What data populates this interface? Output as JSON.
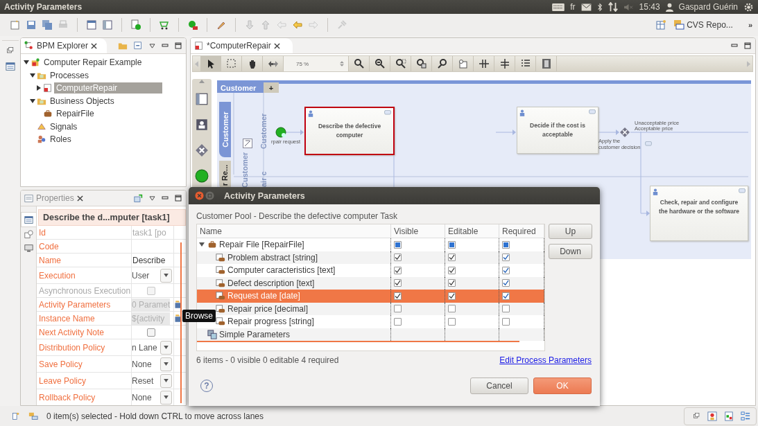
{
  "window": {
    "title": "Activity Parameters"
  },
  "top_panel": {
    "keyboard_layout": "fr",
    "clock": "15:43",
    "user": "Gaspard Guérin"
  },
  "toolbar": {
    "perspective": "CVS Repo...",
    "overflow": "»"
  },
  "explorer": {
    "title": "BPM Explorer",
    "tree": [
      {
        "label": "Computer Repair Example",
        "kind": "project",
        "expanded": true,
        "selected": false,
        "children": [
          {
            "label": "Processes",
            "kind": "folder",
            "expanded": true,
            "selected": false,
            "children": [
              {
                "label": "ComputerRepair",
                "kind": "process",
                "selected": true
              }
            ]
          },
          {
            "label": "Business Objects",
            "kind": "folder",
            "expanded": true,
            "selected": false,
            "children": [
              {
                "label": "RepairFile",
                "kind": "object",
                "selected": false
              }
            ]
          },
          {
            "label": "Signals",
            "kind": "signal",
            "selected": false
          },
          {
            "label": "Roles",
            "kind": "role",
            "selected": false
          }
        ]
      }
    ]
  },
  "properties": {
    "title": "Properties",
    "header": "Describe the d...mputer [task1]",
    "rows": [
      {
        "label": "Id",
        "kind": "readonly",
        "value": "task1  [po",
        "disabled": false
      },
      {
        "label": "Code",
        "kind": "text",
        "disabled": false
      },
      {
        "label": "Name",
        "kind": "text",
        "value": "Describe",
        "disabled": false
      },
      {
        "label": "Execution",
        "kind": "combo",
        "value": "User",
        "disabled": false
      },
      {
        "label": "Asynchronous Execution",
        "kind": "checkbox",
        "checked": false,
        "disabled": true
      },
      {
        "label": "Activity Parameters",
        "kind": "browse",
        "value": "0 Paramet",
        "disabled": false
      },
      {
        "label": "Instance Name",
        "kind": "browse",
        "value": "${activity",
        "disabled": false
      },
      {
        "label": "Next Activity Note",
        "kind": "checkbox",
        "checked": false,
        "disabled": false
      },
      {
        "label": "Distribution Policy",
        "kind": "combo",
        "value": "n Lane",
        "disabled": false
      },
      {
        "label": "Save Policy",
        "kind": "combo",
        "value": "None",
        "disabled": false
      },
      {
        "label": "Leave Policy",
        "kind": "combo",
        "value": "Reset",
        "disabled": false
      },
      {
        "label": "Rollback Policy",
        "kind": "combo",
        "value": "None",
        "disabled": false
      }
    ]
  },
  "tooltip": "Browse",
  "editor": {
    "tab": "*ComputerRepair",
    "zoom": "75 %"
  },
  "diagram": {
    "pool": "Customer",
    "pool_add": "+",
    "pool_tabs": [
      {
        "label": "Customer",
        "selected": true
      },
      {
        "label": "r Re...",
        "selected": false
      }
    ],
    "lane_labels": [
      "Customer",
      "Customer",
      "air c"
    ],
    "start_label": "rpair request",
    "tasks": [
      {
        "label": "Describe the defective computer",
        "selected": true
      },
      {
        "label": "Decide if the cost is acceptable",
        "selected": false
      },
      {
        "label": "Check, repair and configure the hardware or the software",
        "selected": false
      }
    ],
    "gateway_label": "Apply the customer decision",
    "edge_labels": [
      "Unacceptable price",
      "Acceptable price"
    ]
  },
  "dialog": {
    "title": "Activity Parameters",
    "context": "Customer Pool  - Describe the defective computer Task",
    "columns": [
      "Name",
      "Visible",
      "Editable",
      "Required"
    ],
    "rows": [
      {
        "label": "Repair File [RepairFile]",
        "kind": "object",
        "expanded": true,
        "selected": false,
        "partial": true,
        "visible": true,
        "editable": true,
        "required": true,
        "children": [
          {
            "label": "Problem abstract [string]",
            "kind": "attribute",
            "selected": false,
            "visible": true,
            "editable": true,
            "required": true
          },
          {
            "label": "Computer caracteristics [text]",
            "kind": "attribute",
            "selected": false,
            "visible": true,
            "editable": true,
            "required": true
          },
          {
            "label": "Defect description [text]",
            "kind": "attribute",
            "selected": false,
            "visible": true,
            "editable": true,
            "required": true
          },
          {
            "label": "Request date [date]",
            "kind": "attribute",
            "selected": true,
            "visible": true,
            "editable": true,
            "required": true
          },
          {
            "label": "Repair price [decimal]",
            "kind": "attribute",
            "selected": false,
            "visible": false,
            "editable": false,
            "required": false
          },
          {
            "label": "Repair progress [string]",
            "kind": "attribute",
            "selected": false,
            "visible": false,
            "editable": false,
            "required": false
          }
        ]
      },
      {
        "label": "Simple Parameters",
        "kind": "group",
        "selected": false
      }
    ],
    "side_buttons": [
      "Up",
      "Down"
    ],
    "summary": "6 items - 0 visible  0 editable  4 required",
    "link": "Edit Process Parameters",
    "help": "?",
    "buttons": [
      {
        "label": "Cancel",
        "kind": "secondary"
      },
      {
        "label": "OK",
        "kind": "primary"
      }
    ]
  },
  "status_bar": {
    "text": "0 item(s) selected - Hold down CTRL to move across lanes"
  }
}
